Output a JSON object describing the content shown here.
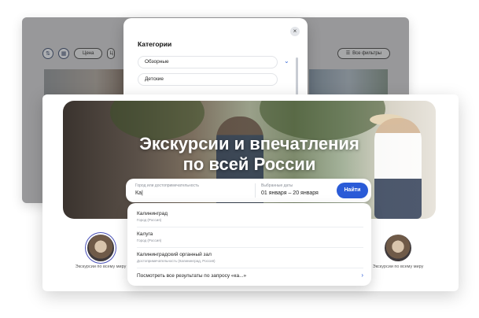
{
  "back": {
    "filters": {
      "price_label": "Цена",
      "partial_label": "Ц",
      "all_filters_label": "Все фильтры"
    }
  },
  "categories_modal": {
    "title": "Категории",
    "items": [
      "Обзорные",
      "Детские"
    ]
  },
  "hero": {
    "title_line1": "Экскурсии и впечатления",
    "title_line2": "по всей России"
  },
  "search": {
    "city_label": "Город или достопримечательность",
    "city_value": "Ка|",
    "dates_label": "Выбранные даты",
    "dates_value": "01 января – 20 января",
    "find_label": "Найти"
  },
  "suggestions": {
    "items": [
      {
        "title": "Калининград",
        "subtitle": "Город (Россия)"
      },
      {
        "title": "Калуга",
        "subtitle": "Город (Россия)"
      },
      {
        "title": "Калининградский органный зал",
        "subtitle": "Достопримечательность (Калининград, Россия)"
      }
    ],
    "see_all": "Посмотреть все результаты по запросу «ка...»"
  },
  "categories": [
    {
      "label": "Экскурсии по всему миру"
    },
    {
      "label": "Экскурсии по всему миру"
    }
  ]
}
